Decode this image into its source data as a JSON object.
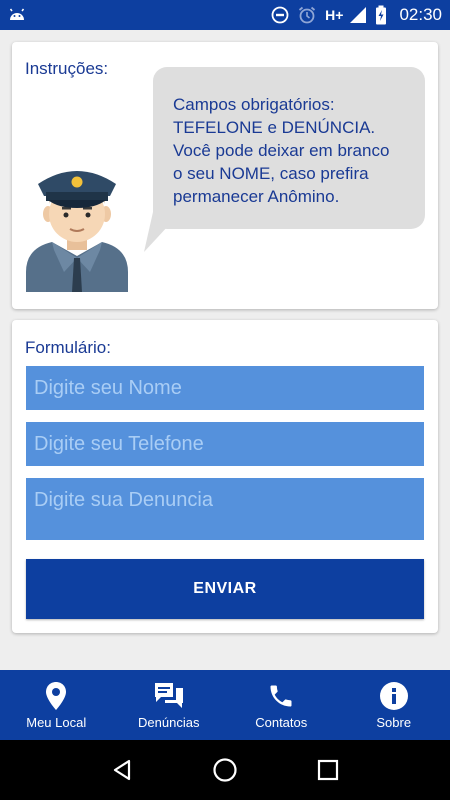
{
  "status_bar": {
    "network": "H+",
    "time": "02:30",
    "colors": {
      "background": "#0d3fa0"
    }
  },
  "instructions": {
    "label": "Instruções:",
    "bubble_lines": [
      "Campos obrigatórios:",
      "TEFELONE e DENÚNCIA.",
      "Você pode deixar em branco",
      "o seu NOME, caso prefira",
      "permanecer Anômino."
    ]
  },
  "form": {
    "label": "Formulário:",
    "name_placeholder": "Digite seu Nome",
    "name_value": "",
    "phone_placeholder": "Digite seu Telefone",
    "phone_value": "",
    "complaint_placeholder": "Digite sua Denuncia",
    "complaint_value": "",
    "submit_label": "ENVIAR"
  },
  "bottom_nav": {
    "items": [
      {
        "label": "Meu Local",
        "icon": "location-pin-icon"
      },
      {
        "label": "Denúncias",
        "icon": "chat-bubbles-icon"
      },
      {
        "label": "Contatos",
        "icon": "phone-icon"
      },
      {
        "label": "Sobre",
        "icon": "info-icon"
      }
    ]
  },
  "theme": {
    "primary": "#0d3fa0",
    "input_bg": "#5591dc",
    "text_blue": "#1a3a94",
    "bubble_bg": "#dedede"
  }
}
